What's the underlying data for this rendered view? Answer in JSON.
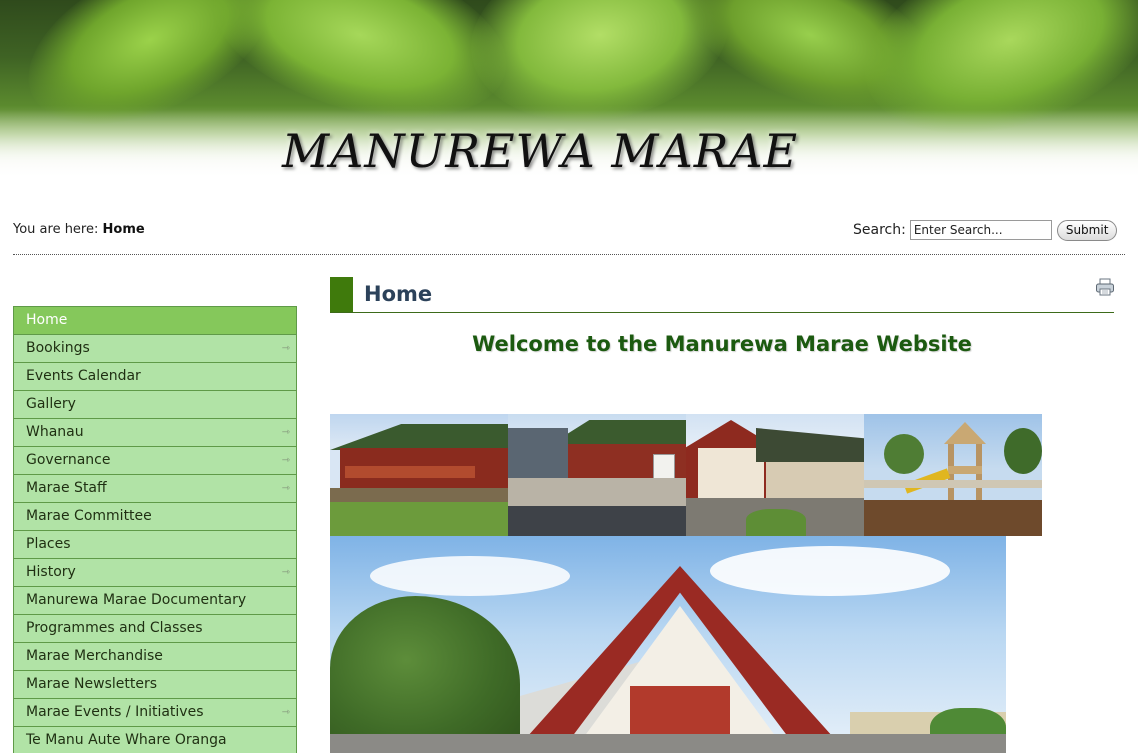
{
  "site": {
    "title": "MANUREWA MARAE"
  },
  "breadcrumb": {
    "prefix": "You are here:",
    "current": "Home"
  },
  "search": {
    "label": "Search:",
    "value": "Enter Search...",
    "submit_label": "Submit"
  },
  "menu": {
    "items": [
      {
        "label": "Home",
        "active": true,
        "has_submenu": false
      },
      {
        "label": "Bookings",
        "has_submenu": true
      },
      {
        "label": "Events Calendar",
        "has_submenu": false
      },
      {
        "label": "Gallery",
        "has_submenu": false
      },
      {
        "label": "Whanau",
        "has_submenu": true
      },
      {
        "label": "Governance",
        "has_submenu": true
      },
      {
        "label": "Marae Staff",
        "has_submenu": true
      },
      {
        "label": "Marae Committee",
        "has_submenu": false
      },
      {
        "label": "Places",
        "has_submenu": false
      },
      {
        "label": "History",
        "has_submenu": true
      },
      {
        "label": "Manurewa Marae Documentary",
        "has_submenu": false
      },
      {
        "label": "Programmes and Classes",
        "has_submenu": false
      },
      {
        "label": "Marae Merchandise",
        "has_submenu": false
      },
      {
        "label": "Marae Newsletters",
        "has_submenu": false
      },
      {
        "label": "Marae Events / Initiatives",
        "has_submenu": true
      },
      {
        "label": "Te Manu Aute Whare Oranga",
        "has_submenu": false
      }
    ],
    "submenu_glyph": "⇾"
  },
  "content": {
    "page_title": "Home",
    "welcome_heading": "Welcome to the Manurewa Marae Website",
    "print_icon": "printer-icon"
  },
  "colors": {
    "menu_bg": "#b1e3a6",
    "menu_active_bg": "#85c85b",
    "menu_border": "#5f9a48",
    "heading_bar": "#3f7a0c",
    "page_title": "#2c425a",
    "welcome_text": "#1c5a10"
  }
}
